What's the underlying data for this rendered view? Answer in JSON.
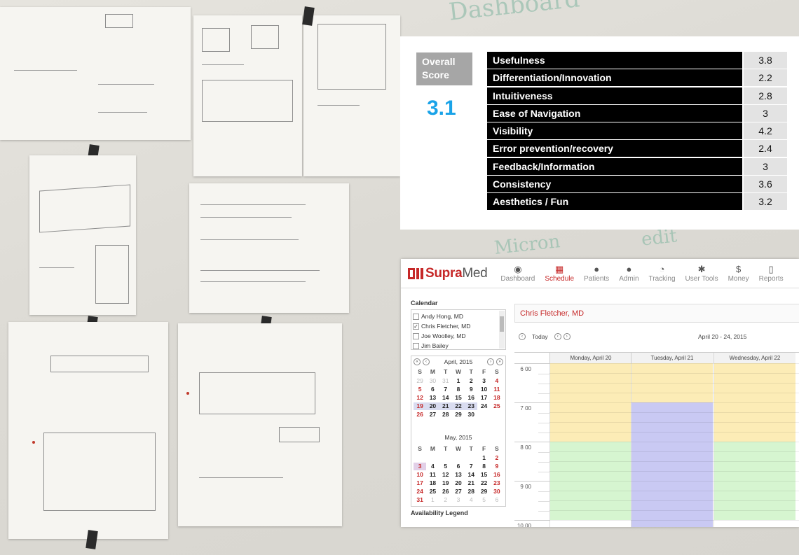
{
  "whiteboard": {
    "marker_notes": [
      "Dashboard",
      "Micron",
      "edit"
    ]
  },
  "score": {
    "overall_label": "Overall Score",
    "overall_value": "3.1",
    "metrics": [
      {
        "name": "Usefulness",
        "value": "3.8"
      },
      {
        "name": "Differentiation/Innovation",
        "value": "2.2"
      },
      {
        "name": "Intuitiveness",
        "value": "2.8"
      },
      {
        "name": "Ease of Navigation",
        "value": "3"
      },
      {
        "name": "Visibility",
        "value": "4.2"
      },
      {
        "name": "Error prevention/recovery",
        "value": "2.4"
      },
      {
        "name": "Feedback/Information",
        "value": "3"
      },
      {
        "name": "Consistency",
        "value": "3.6"
      },
      {
        "name": "Aesthetics / Fun",
        "value": "3.2"
      }
    ],
    "colors": {
      "label_bg": "#000000",
      "value_bg": "#e3e3e3",
      "overall_accent": "#1aa3e8"
    }
  },
  "app": {
    "logo_part1": "Supra",
    "logo_part2": "Med",
    "nav": [
      {
        "label": "Dashboard",
        "icon": "dashboard-icon",
        "glyph": "◉"
      },
      {
        "label": "Schedule",
        "icon": "calendar-icon",
        "glyph": "▦"
      },
      {
        "label": "Patients",
        "icon": "patients-icon",
        "glyph": "●"
      },
      {
        "label": "Admin",
        "icon": "admin-icon",
        "glyph": "●"
      },
      {
        "label": "Tracking",
        "icon": "tracking-icon",
        "glyph": "◔"
      },
      {
        "label": "User Tools",
        "icon": "gear-icon",
        "glyph": "✱"
      },
      {
        "label": "Money",
        "icon": "dollar-icon",
        "glyph": "$"
      },
      {
        "label": "Reports",
        "icon": "reports-icon",
        "glyph": "▯"
      }
    ],
    "active_nav": "Schedule",
    "sidebar": {
      "calendar_title": "Calendar",
      "calendars": [
        {
          "name": "Andy Hong, MD",
          "checked": false
        },
        {
          "name": "Chris Fletcher, MD",
          "checked": true
        },
        {
          "name": "Joe Woolley, MD",
          "checked": false
        },
        {
          "name": "Jim Bailey",
          "checked": false
        }
      ],
      "month1": {
        "title": "April, 2015",
        "dow": [
          "S",
          "M",
          "T",
          "W",
          "T",
          "F",
          "S"
        ],
        "days": [
          "29",
          "30",
          "31",
          "1",
          "2",
          "3",
          "4",
          "5",
          "6",
          "7",
          "8",
          "9",
          "10",
          "11",
          "12",
          "13",
          "14",
          "15",
          "16",
          "17",
          "18",
          "19",
          "20",
          "21",
          "22",
          "23",
          "24",
          "25",
          "26",
          "27",
          "28",
          "29",
          "30"
        ]
      },
      "month2": {
        "title": "May, 2015",
        "dow": [
          "S",
          "M",
          "T",
          "W",
          "T",
          "F",
          "S"
        ],
        "days": [
          "",
          "",
          "",
          "",
          "",
          "1",
          "2",
          "3",
          "4",
          "5",
          "6",
          "7",
          "8",
          "9",
          "10",
          "11",
          "12",
          "13",
          "14",
          "15",
          "16",
          "17",
          "18",
          "19",
          "20",
          "21",
          "22",
          "23",
          "24",
          "25",
          "26",
          "27",
          "28",
          "29",
          "30",
          "31",
          "1",
          "2",
          "3",
          "4",
          "5",
          "6"
        ]
      },
      "legend_title": "Availability Legend"
    },
    "main": {
      "patient_name": "Chris Fletcher, MD",
      "today_label": "Today",
      "week_range": "April 20 - 24, 2015",
      "days": [
        "Monday, April 20",
        "Tuesday, April 21",
        "Wednesday, April 22"
      ],
      "hours": [
        "6",
        "7",
        "8",
        "9",
        "10"
      ],
      "minutes_label": "00"
    },
    "colors": {
      "brand": "#c62828",
      "available": "#fcecb6",
      "booked": "#c9c9f3",
      "open": "#d6f5d0"
    }
  }
}
